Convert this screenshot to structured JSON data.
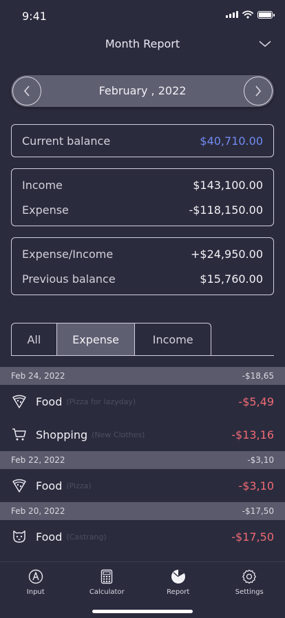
{
  "status": {
    "time": "9:41"
  },
  "header": {
    "title": "Month Report"
  },
  "month": {
    "label": "February , 2022"
  },
  "balance": {
    "label": "Current balance",
    "value": "$40,710.00",
    "accent": "#6f8cf0"
  },
  "summary": {
    "income_label": "Income",
    "income_value": "$143,100.00",
    "expense_label": "Expense",
    "expense_value": "-$118,150.00"
  },
  "ratio": {
    "diff_label": "Expense/Income",
    "diff_value": "+$24,950.00",
    "prev_label": "Previous balance",
    "prev_value": "$15,760.00"
  },
  "tabs": [
    {
      "label": "All"
    },
    {
      "label": "Expense"
    },
    {
      "label": "Income"
    }
  ],
  "groups": [
    {
      "date": "Feb 24, 2022",
      "total": "-$18,65",
      "items": [
        {
          "icon": "pizza-icon",
          "category": "Food",
          "note": "(Pizza for lazyday)",
          "amount": "-$5,49"
        },
        {
          "icon": "cart-icon",
          "category": "Shopping",
          "note": "(New Clothes)",
          "amount": "-$13,16"
        }
      ]
    },
    {
      "date": "Feb 22, 2022",
      "total": "-$3,10",
      "items": [
        {
          "icon": "pizza-icon",
          "category": "Food",
          "note": "(Pizza)",
          "amount": "-$3,10"
        }
      ]
    },
    {
      "date": "Feb 20, 2022",
      "total": "-$17,50",
      "items": [
        {
          "icon": "cat-icon",
          "category": "Food",
          "note": "(Castrang)",
          "amount": "-$17,50"
        }
      ]
    }
  ],
  "nav": [
    {
      "label": "Input",
      "icon": "pencil-icon"
    },
    {
      "label": "Calculator",
      "icon": "calculator-icon"
    },
    {
      "label": "Report",
      "icon": "pie-chart-icon"
    },
    {
      "label": "Settings",
      "icon": "gear-icon"
    }
  ],
  "colors": {
    "background": "#2b2b3e",
    "expense": "#ef6b73",
    "panel": "#5f5f72"
  }
}
